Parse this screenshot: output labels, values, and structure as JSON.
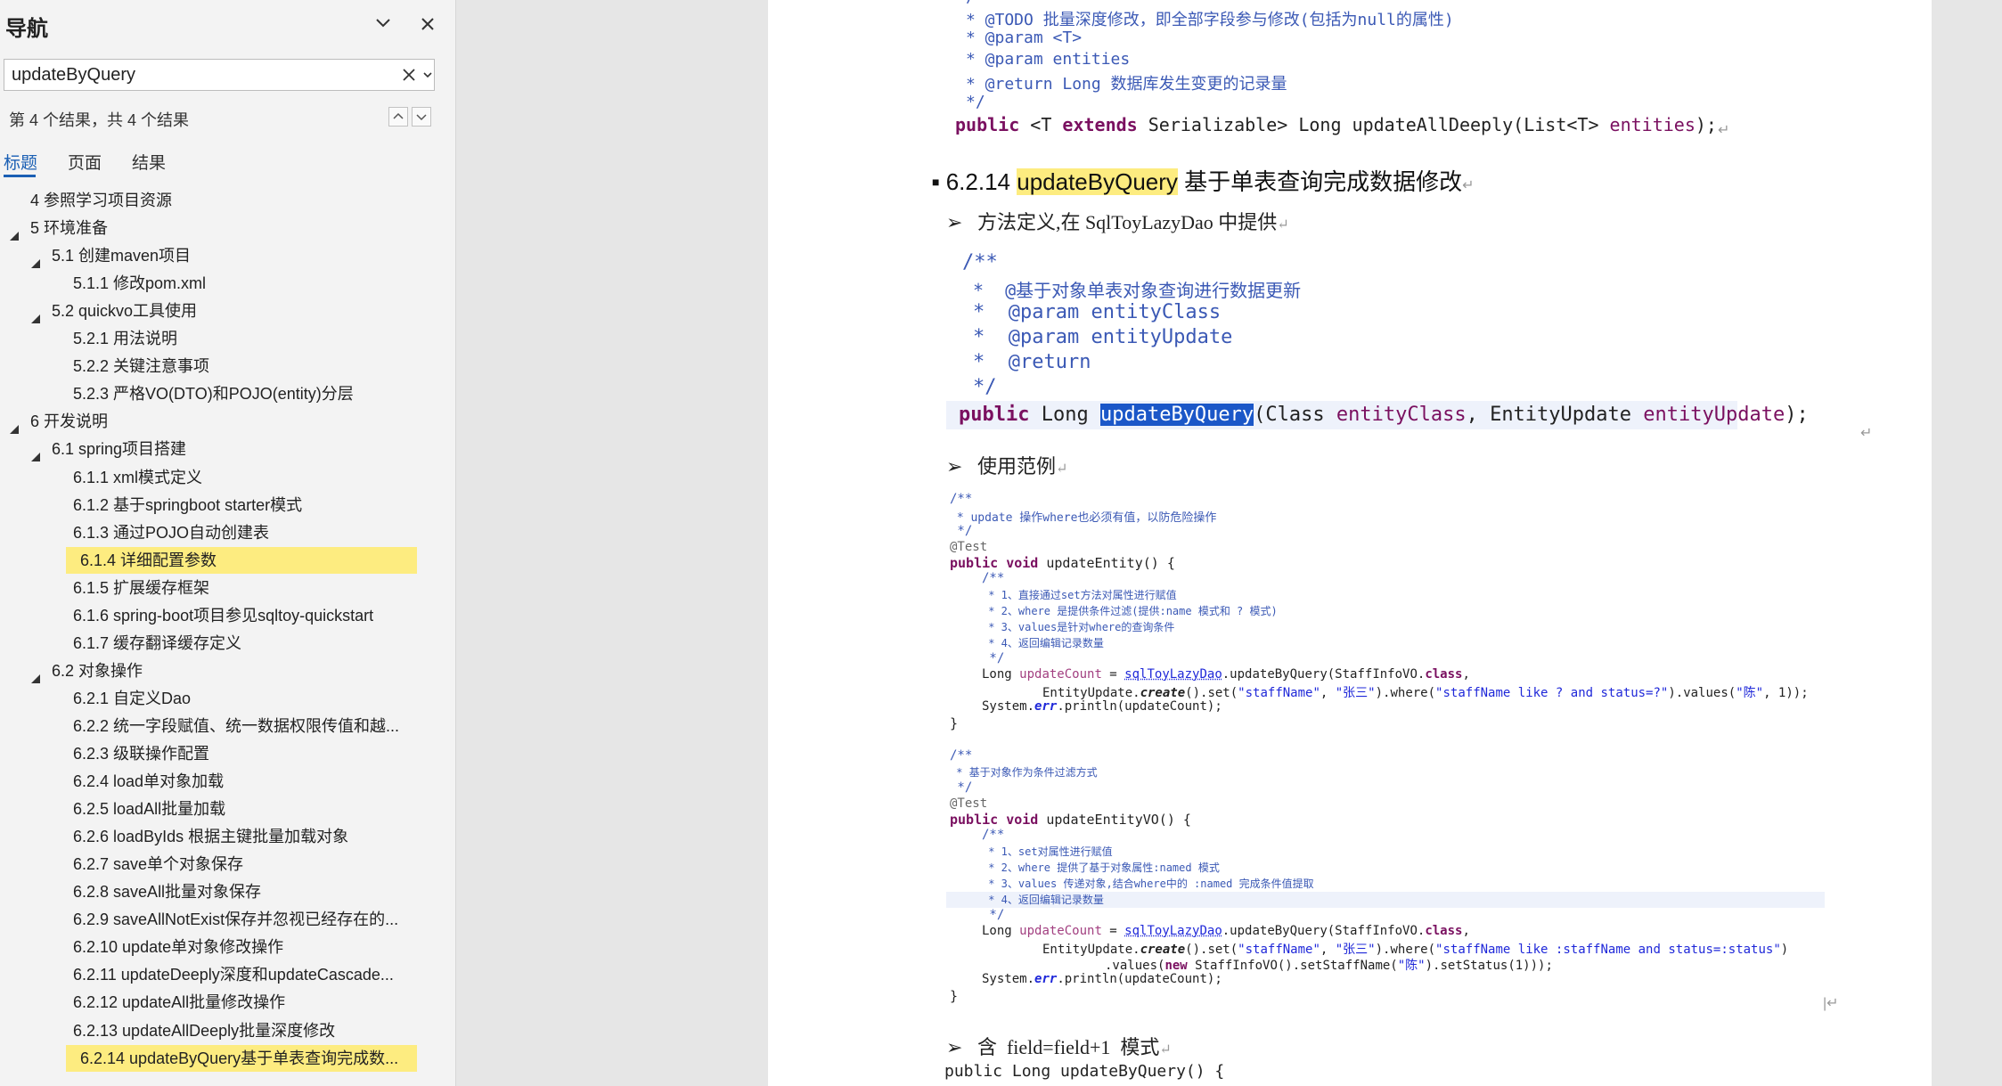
{
  "nav": {
    "title": "导航",
    "search_value": "updateByQuery",
    "result_text": "第 4 个结果，共 4 个结果",
    "tabs": [
      "标题",
      "页面",
      "结果"
    ],
    "active_tab": "标题",
    "outline": [
      {
        "label": "4 参照学习项目资源",
        "level": 1,
        "expanded": null,
        "highlighted": false
      },
      {
        "label": "5 环境准备",
        "level": 1,
        "expanded": true,
        "highlighted": false
      },
      {
        "label": "5.1 创建maven项目",
        "level": 2,
        "expanded": true,
        "highlighted": false
      },
      {
        "label": "5.1.1 修改pom.xml",
        "level": 3,
        "expanded": null,
        "highlighted": false
      },
      {
        "label": "5.2 quickvo工具使用",
        "level": 2,
        "expanded": true,
        "highlighted": false
      },
      {
        "label": "5.2.1 用法说明",
        "level": 3,
        "expanded": null,
        "highlighted": false
      },
      {
        "label": "5.2.2 关键注意事项",
        "level": 3,
        "expanded": null,
        "highlighted": false
      },
      {
        "label": "5.2.3 严格VO(DTO)和POJO(entity)分层",
        "level": 3,
        "expanded": null,
        "highlighted": false
      },
      {
        "label": "6 开发说明",
        "level": 1,
        "expanded": true,
        "highlighted": false
      },
      {
        "label": "6.1  spring项目搭建",
        "level": 2,
        "expanded": true,
        "highlighted": false
      },
      {
        "label": "6.1.1 xml模式定义",
        "level": 3,
        "expanded": null,
        "highlighted": false
      },
      {
        "label": "6.1.2 基于springboot starter模式",
        "level": 3,
        "expanded": null,
        "highlighted": false
      },
      {
        "label": "6.1.3 通过POJO自动创建表",
        "level": 3,
        "expanded": null,
        "highlighted": false
      },
      {
        "label": "6.1.4 详细配置参数",
        "level": 3,
        "expanded": null,
        "highlighted": true
      },
      {
        "label": "6.1.5 扩展缓存框架",
        "level": 3,
        "expanded": null,
        "highlighted": false
      },
      {
        "label": "6.1.6 spring-boot项目参见sqltoy-quickstart",
        "level": 3,
        "expanded": null,
        "highlighted": false
      },
      {
        "label": "6.1.7 缓存翻译缓存定义",
        "level": 3,
        "expanded": null,
        "highlighted": false
      },
      {
        "label": "6.2 对象操作",
        "level": 2,
        "expanded": true,
        "highlighted": false
      },
      {
        "label": "6.2.1 自定义Dao",
        "level": 3,
        "expanded": null,
        "highlighted": false
      },
      {
        "label": "6.2.2 统一字段赋值、统一数据权限传值和越...",
        "level": 3,
        "expanded": null,
        "highlighted": false
      },
      {
        "label": "6.2.3 级联操作配置",
        "level": 3,
        "expanded": null,
        "highlighted": false
      },
      {
        "label": "6.2.4 load单对象加载",
        "level": 3,
        "expanded": null,
        "highlighted": false
      },
      {
        "label": "6.2.5 loadAll批量加载",
        "level": 3,
        "expanded": null,
        "highlighted": false
      },
      {
        "label": "6.2.6 loadByIds 根据主键批量加载对象",
        "level": 3,
        "expanded": null,
        "highlighted": false
      },
      {
        "label": "6.2.7 save单个对象保存",
        "level": 3,
        "expanded": null,
        "highlighted": false
      },
      {
        "label": "6.2.8 saveAll批量对象保存",
        "level": 3,
        "expanded": null,
        "highlighted": false
      },
      {
        "label": "6.2.9 saveAllNotExist保存并忽视已经存在的...",
        "level": 3,
        "expanded": null,
        "highlighted": false
      },
      {
        "label": "6.2.10 update单对象修改操作",
        "level": 3,
        "expanded": null,
        "highlighted": false
      },
      {
        "label": "6.2.11 updateDeeply深度和updateCascade...",
        "level": 3,
        "expanded": null,
        "highlighted": false
      },
      {
        "label": "6.2.12 updateAll批量修改操作",
        "level": 3,
        "expanded": null,
        "highlighted": false
      },
      {
        "label": "6.2.13 updateAllDeeply批量深度修改",
        "level": 3,
        "expanded": null,
        "highlighted": false
      },
      {
        "label": "6.2.14 updateByQuery基于单表查询完成数...",
        "level": 3,
        "expanded": null,
        "highlighted": true
      }
    ]
  },
  "doc": {
    "top_javadoc": [
      "* @TODO 批量深度修改，即全部字段参与修改(包括为null的属性)",
      "* @param <T>",
      "* @param entities",
      "* @return Long 数据库发生变更的记录量",
      "*/"
    ],
    "top_sig": {
      "kw1": "public",
      "p1": " <T ",
      "kw2": "extends",
      "p2": " Serializable> Long updateAllDeeply(List<T> ",
      "param": "entities",
      "p3": ");"
    },
    "heading": {
      "number": "6.2.14",
      "match": "updateByQuery",
      "rest": "基于单表查询完成数据修改"
    },
    "bullet1": "方法定义,在 SqlToyLazyDao 中提供",
    "def_javadoc": [
      "/**",
      "*  @基于对象单表对象查询进行数据更新",
      "*  @param entityClass",
      "*  @param entityUpdate",
      "*  @return",
      "*/"
    ],
    "def_sig": {
      "kw": "public",
      "p1": " Long ",
      "sel": "updateByQuery",
      "p2": "(Class ",
      "a1": "entityClass",
      "p3": ", EntityUpdate ",
      "a2": "entityUpdate",
      "p4": ");"
    },
    "bullet2": "使用范例",
    "ex1": {
      "c1": "/**",
      "c2": " * update 操作where也必须有值，以防危险操作",
      "c3": " */",
      "ann": "@Test",
      "sig_kw": "public void",
      "sig": " updateEntity() {",
      "inner": [
        "/**",
        " * 1、直接通过set方法对属性进行赋值",
        " * 2、where 是提供条件过滤(提供:name 模式和 ? 模式)",
        " * 3、values是针对where的查询条件",
        " * 4、返回编辑记录数量",
        " */"
      ],
      "l1a": "Long ",
      "l1v": "updateCount",
      "l1b": " = ",
      "l1f": "sqlToyLazyDao",
      "l1c": ".updateByQuery(StaffInfoVO.",
      "l1k": "class",
      "l1d": ",",
      "l2a": "EntityUpdate.",
      "l2i": "create",
      "l2b": "().set(",
      "l2s1": "\"staffName\"",
      "l2c": ", ",
      "l2s2": "\"张三\"",
      "l2d": ").where(",
      "l2s3": "\"staffName like ? and status=?\"",
      "l2e": ").values(",
      "l2s4": "\"陈\"",
      "l2f": ", 1));",
      "l3a": "System.",
      "l3i": "err",
      "l3b": ".println(updateCount);",
      "close": "}"
    },
    "ex2": {
      "c1": "/**",
      "c2": " * 基于对象作为条件过滤方式",
      "c3": " */",
      "ann": "@Test",
      "sig_kw": "public void",
      "sig": " updateEntityVO() {",
      "inner": [
        "/**",
        " * 1、set对属性进行赋值",
        " * 2、where 提供了基于对象属性:named 模式",
        " * 3、values 传递对象,结合where中的 :named 完成条件值提取",
        " * 4、返回编辑记录数量",
        " */"
      ],
      "l1a": "Long ",
      "l1v": "updateCount",
      "l1b": " = ",
      "l1f": "sqlToyLazyDao",
      "l1c": ".updateByQuery(StaffInfoVO.",
      "l1k": "class",
      "l1d": ",",
      "l2a": "EntityUpdate.",
      "l2i": "create",
      "l2b": "().set(",
      "l2s1": "\"staffName\"",
      "l2c": ", ",
      "l2s2": "\"张三\"",
      "l2d": ").where(",
      "l2s3": "\"staffName like :staffName and status=:status\"",
      "l2e": ")",
      "l3pre": ".values(",
      "l3new": "new",
      "l3mid": " StaffInfoVO().setStaffName(",
      "l3s": "\"陈\"",
      "l3end": ").setStatus(1)));",
      "l4a": "System.",
      "l4i": "err",
      "l4b": ".println(updateCount);",
      "close": "}"
    },
    "bullet3": "含  field=field+1  模式",
    "last_sig": "public Long updateByQuery() {"
  }
}
